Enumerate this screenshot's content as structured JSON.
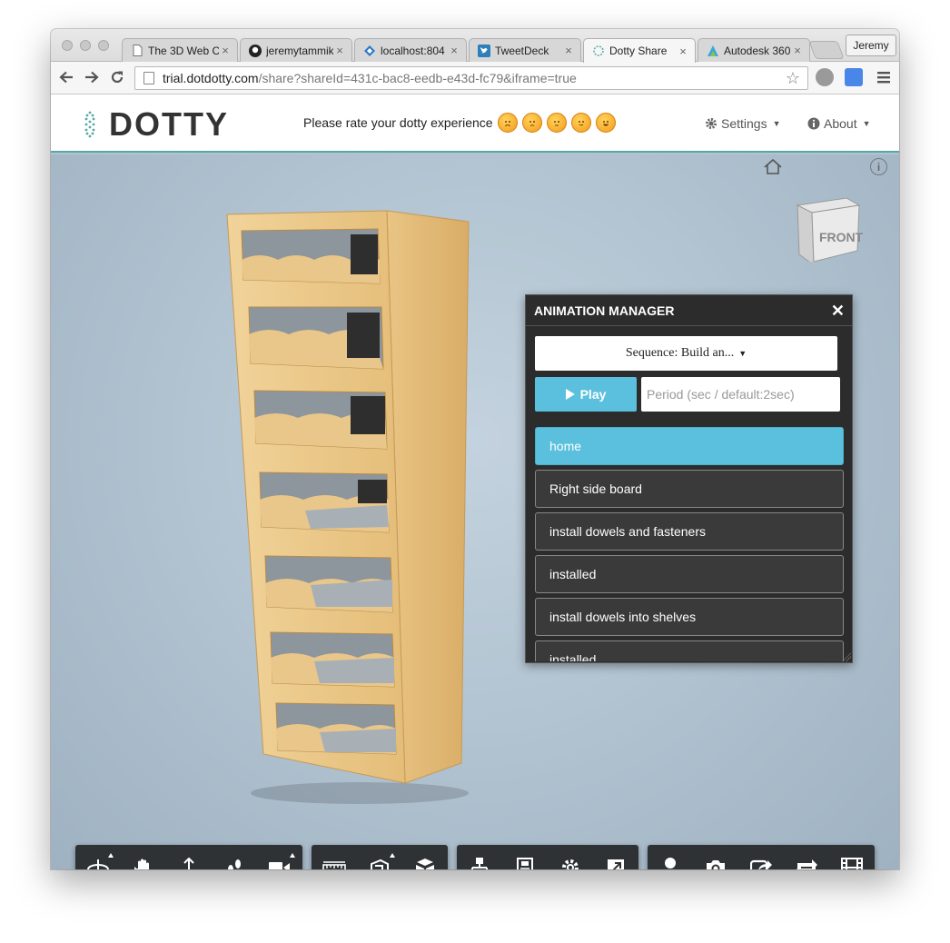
{
  "browser": {
    "tabs": [
      {
        "title": "The 3D Web C",
        "icon": "page-icon",
        "active": false
      },
      {
        "title": "jeremytammik",
        "icon": "github-icon",
        "active": false
      },
      {
        "title": "localhost:804",
        "icon": "code-icon",
        "active": false
      },
      {
        "title": "TweetDeck",
        "icon": "twitter-icon",
        "active": false
      },
      {
        "title": "Dotty Share",
        "icon": "dotty-icon",
        "active": true
      },
      {
        "title": "Autodesk 360",
        "icon": "autodesk-icon",
        "active": false
      }
    ],
    "profile_name": "Jeremy",
    "url_host": "trial.dotdotty.com",
    "url_path": "/share?shareId=431c-bac8-eedb-e43d-fc79&iframe=true"
  },
  "app": {
    "logo": "DOTTY",
    "rating_prompt": "Please rate your dotty experience",
    "rating_icons": [
      "angry-face-icon",
      "sad-face-icon",
      "neutral-face-icon",
      "smile-face-icon",
      "happy-face-icon"
    ],
    "settings_label": "Settings",
    "about_label": "About",
    "accent": "#54a7a3"
  },
  "viewer": {
    "viewcube_label": "FRONT"
  },
  "animation_manager": {
    "title": "ANIMATION MANAGER",
    "sequence_label": "Sequence: Build an...",
    "play_label": "Play",
    "period_placeholder": "Period (sec / default:2sec)",
    "steps": [
      {
        "label": "home",
        "active": true
      },
      {
        "label": "Right side board",
        "active": false
      },
      {
        "label": "install dowels and fasteners",
        "active": false
      },
      {
        "label": "installed",
        "active": false
      },
      {
        "label": "install dowels into shelves",
        "active": false
      },
      {
        "label": "installed",
        "active": false
      }
    ],
    "active_color": "#5bc0de"
  },
  "bottom_toolbar": {
    "groups": [
      [
        "orbit-icon",
        "pan-icon",
        "dolly-icon",
        "walk-icon",
        "camera-icon"
      ],
      [
        "measure-icon",
        "section-icon",
        "explode-icon"
      ],
      [
        "model-structure-icon",
        "properties-icon",
        "settings-icon",
        "fullscreen-icon"
      ],
      [
        "user-icon",
        "screenshot-icon",
        "share-icon",
        "loop-icon",
        "film-icon"
      ]
    ]
  }
}
